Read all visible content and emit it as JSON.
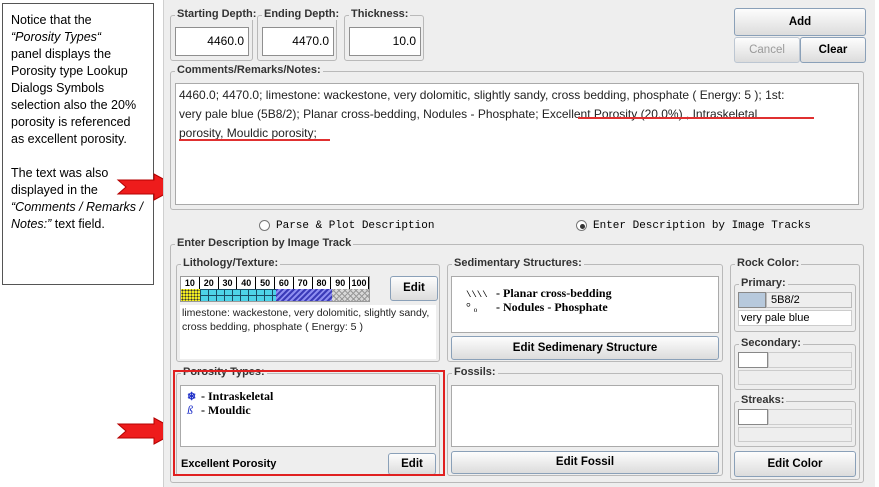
{
  "annotation": {
    "p1_a": "Notice that the",
    "p1_b": "“Porosity Types“",
    "p1_c": "panel displays the Porosity type Lookup Dialogs Symbols selection also the 20% porosity is referenced as excellent porosity.",
    "p2_a": "The  text was also displayed in the",
    "p2_b": "“Comments / Remarks / Notes:”",
    "p2_c": "text field."
  },
  "depth": {
    "starting_label": "Starting Depth:",
    "starting_value": "4460.0",
    "ending_label": "Ending Depth:",
    "ending_value": "4470.0",
    "thickness_label": "Thickness:",
    "thickness_value": "10.0"
  },
  "buttons": {
    "add": "Add",
    "cancel": "Cancel",
    "clear": "Clear"
  },
  "comments": {
    "label": "Comments/Remarks/Notes:",
    "line1": "4460.0; 4470.0; limestone:  wackestone, very dolomitic, slightly sandy, cross bedding, phosphate ( Energy: 5 ); 1st:",
    "line2a": "very pale blue (5B8/2); Planar cross-bedding, Nodules - Phosphate; ",
    "line2b": "Excellent Porosity (20.0%) , Intraskeletal",
    "line3": "porosity, Mouldic porosity;"
  },
  "mode": {
    "parse_label": "Parse & Plot Description",
    "enter_label": "Enter Description by Image Tracks",
    "selected": "enter"
  },
  "image_track": {
    "label": "Enter Description by Image Track"
  },
  "lithology": {
    "label": "Lithology/Texture:",
    "scale": [
      "10",
      "20",
      "30",
      "40",
      "50",
      "60",
      "70",
      "80",
      "90",
      "100"
    ],
    "edit": "Edit",
    "description": "limestone:  wackestone, very dolomitic, slightly sandy, cross bedding, phosphate ( Energy: 5 )"
  },
  "sedimentary": {
    "label": "Sedimentary Structures:",
    "items": [
      {
        "symbol": "\\\\\\\\",
        "text": "- Planar cross-bedding"
      },
      {
        "symbol": "° ₒ",
        "text": "- Nodules - Phosphate"
      }
    ],
    "edit": "Edit Sedimenary Structure"
  },
  "rock_color": {
    "label": "Rock Color:",
    "primary_label": "Primary:",
    "primary_code": "5B8/2",
    "primary_name": "very pale blue",
    "primary_swatch": "#b7c9dc",
    "secondary_label": "Secondary:",
    "streaks_label": "Streaks:",
    "edit": "Edit Color"
  },
  "porosity": {
    "label": "Porosity Types:",
    "items": [
      {
        "symbol": "❄",
        "text": "- Intraskeletal"
      },
      {
        "symbol": "ß",
        "text": "- Mouldic"
      }
    ],
    "status": "Excellent Porosity",
    "edit": "Edit"
  },
  "fossils": {
    "label": "Fossils:",
    "edit": "Edit Fossil"
  },
  "colors": {
    "highlight_red": "#e02020",
    "arrow_red": "#ee1c1c",
    "porosity_blue": "#1e2fc8"
  }
}
